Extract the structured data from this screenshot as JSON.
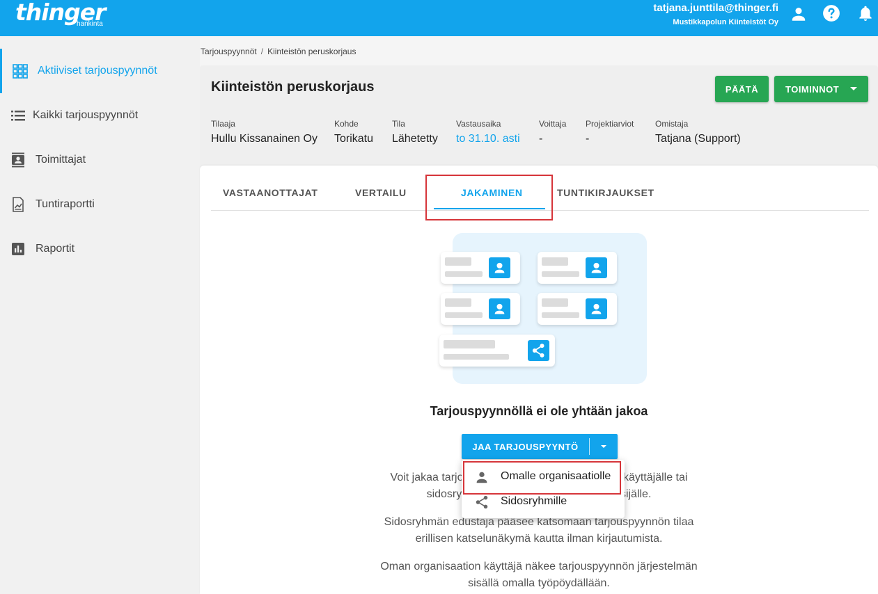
{
  "header": {
    "logo_text": "thinger",
    "logo_sub": "hankinta",
    "user_email": "tatjana.junttila@thinger.fi",
    "user_org": "Mustikkapolun Kiinteistöt Oy",
    "icons": [
      "account-icon",
      "help-icon",
      "bell-icon"
    ]
  },
  "sidebar": {
    "items": [
      {
        "label": "Aktiiviset tarjouspyynnöt",
        "icon": "grid-icon",
        "active": true
      },
      {
        "label": "Kaikki tarjouspyynnöt",
        "icon": "list-icon",
        "active": false
      },
      {
        "label": "Toimittajat",
        "icon": "contacts-icon",
        "active": false
      },
      {
        "label": "Tuntiraportti",
        "icon": "report-icon",
        "active": false
      },
      {
        "label": "Raportit",
        "icon": "bar-chart-icon",
        "active": false
      }
    ]
  },
  "breadcrumb": {
    "items": [
      "Tarjouspyynnöt",
      "Kiinteistön peruskorjaus"
    ],
    "separator": "/"
  },
  "request": {
    "title": "Kiinteistön peruskorjaus",
    "actions": {
      "close_label": "PÄÄTÄ",
      "actions_label": "TOIMINNOT"
    },
    "fields": [
      {
        "label": "Tilaaja",
        "value": "Hullu Kissanainen Oy"
      },
      {
        "label": "Kohde",
        "value": "Torikatu"
      },
      {
        "label": "Tila",
        "value": "Lähetetty"
      },
      {
        "label": "Vastausaika",
        "value": "to 31.10. asti"
      },
      {
        "label": "Voittaja",
        "value": "-"
      },
      {
        "label": "Projektiarviot",
        "value": "-"
      },
      {
        "label": "Omistaja",
        "value": "Tatjana (Support)"
      }
    ]
  },
  "tabs": [
    {
      "label": "VASTAANOTTAJAT",
      "active": false
    },
    {
      "label": "VERTAILU",
      "active": false
    },
    {
      "label": "JAKAMINEN",
      "active": true
    },
    {
      "label": "TUNTIKIRJAUKSET",
      "active": false
    }
  ],
  "sharing": {
    "empty_title": "Tarjouspyynnöllä ei ole yhtään jakoa",
    "share_button": "JAA TARJOUSPYYNTÖ",
    "desc1_line1": "Voit jakaa tarjouspyynnön oman organisaatiosi käyttäjälle tai",
    "desc1_line2": "sidosryhmän edustajalle, esim. isännöitsijälle.",
    "desc2_line1": "Sidosryhmän edustaja pääsee katsomaan tarjouspyynnön tilaa",
    "desc2_line2": "erillisen katselunäkymä kautta ilman kirjautumista.",
    "desc3_line1": "Oman organisaation käyttäjä näkee tarjouspyynnön järjestelmän",
    "desc3_line2": "sisällä omalla työpöydällään."
  },
  "dropdown_menu": {
    "items": [
      {
        "label": "Omalle organisaatiolle",
        "icon": "person-icon"
      },
      {
        "label": "Sidosryhmille",
        "icon": "share-icon"
      }
    ]
  },
  "colors": {
    "brand": "#12a4ec",
    "success": "#27a653",
    "highlight": "#d6353a"
  }
}
